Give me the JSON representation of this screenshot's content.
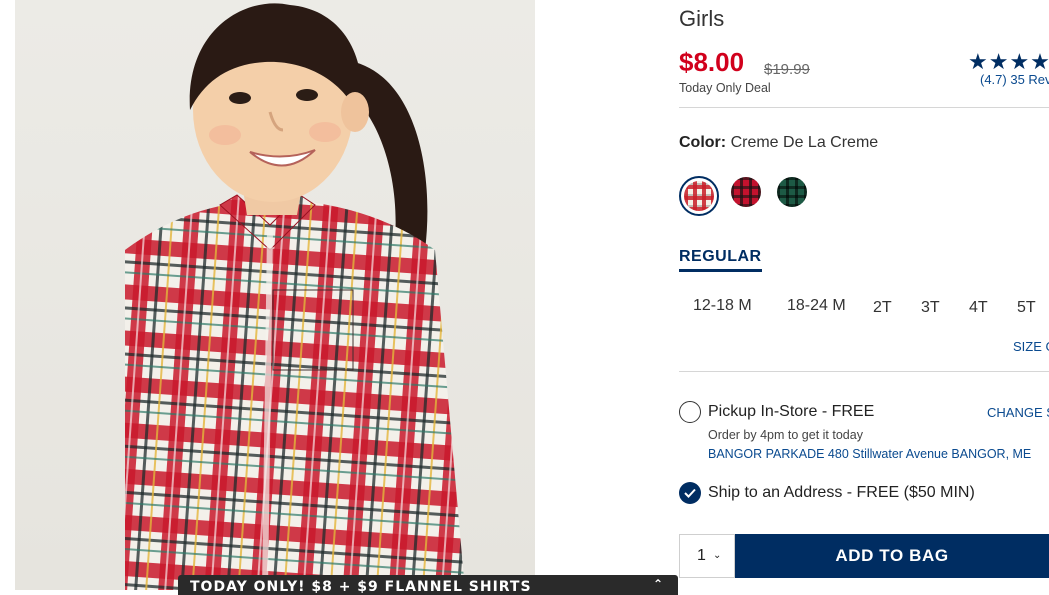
{
  "product": {
    "title": "Girls",
    "price": "$8.00",
    "original_price": "$19.99",
    "deal_note": "Today Only Deal",
    "stars": "★★★★",
    "reviews": "(4.7) 35 Rev"
  },
  "color": {
    "label": "Color:",
    "selected": "Creme De La Creme"
  },
  "fit": {
    "tab": "REGULAR"
  },
  "sizes": [
    "12-18 M",
    "18-24 M",
    "2T",
    "3T",
    "4T",
    "5T"
  ],
  "size_guide": "SIZE G",
  "fulfillment": {
    "pickup_label": "Pickup In-Store - FREE",
    "change_store": "CHANGE S",
    "order_by": "Order by 4pm to get it today",
    "store_address": "BANGOR PARKADE 480 Stillwater Avenue  BANGOR, ME",
    "ship_label": "Ship to an Address - FREE ($50 MIN)"
  },
  "purchase": {
    "quantity": "1",
    "add_to_bag": "ADD TO BAG"
  },
  "promo": {
    "text": "TODAY ONLY! $8 + $9 FLANNEL SHIRTS"
  },
  "colors": {
    "brand_navy": "#002d62",
    "sale_red": "#d1001c"
  }
}
